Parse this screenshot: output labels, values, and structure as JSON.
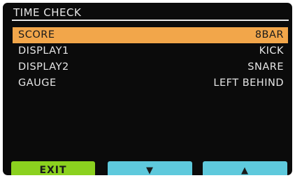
{
  "screen": {
    "title": "TIME CHECK"
  },
  "menu": {
    "items": [
      {
        "label": "SCORE",
        "value": "8BAR",
        "selected": true
      },
      {
        "label": "DISPLAY1",
        "value": "KICK",
        "selected": false
      },
      {
        "label": "DISPLAY2",
        "value": "SNARE",
        "selected": false
      },
      {
        "label": "GAUGE",
        "value": "LEFT BEHIND",
        "selected": false
      }
    ]
  },
  "softkeys": {
    "exit_label": "EXIT",
    "down_glyph": "▼",
    "up_glyph": "▲"
  },
  "colors": {
    "screen_bg": "#0b0b0b",
    "text": "#e6e6e6",
    "selection": "#f2a64a",
    "exit_key": "#8bd11f",
    "arrow_keys": "#5ec9dc"
  },
  "icons": {
    "down": "triangle-down-icon",
    "up": "triangle-up-icon"
  }
}
